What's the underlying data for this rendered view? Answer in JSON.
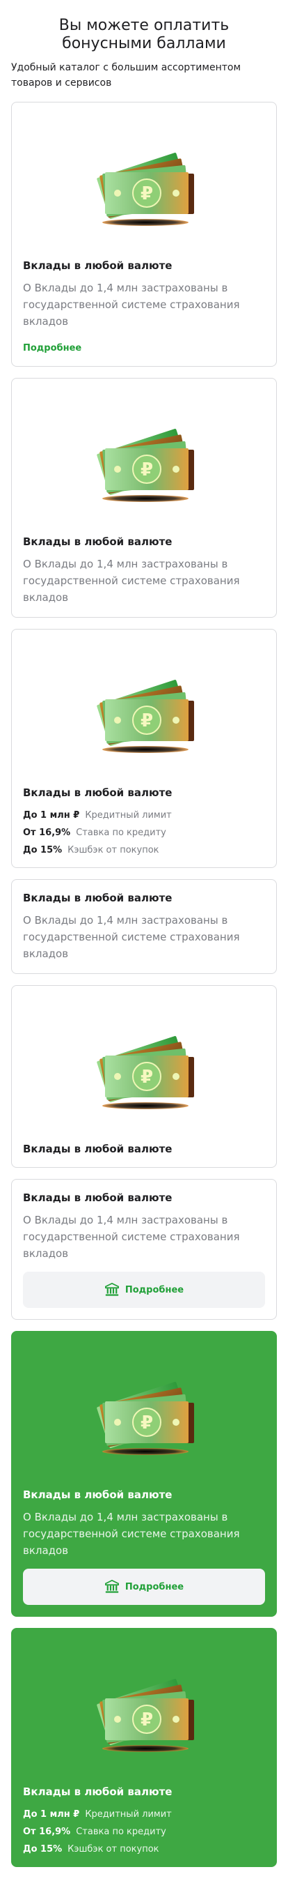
{
  "header": {
    "title": "Вы можете оплатить бонусными баллами",
    "subtitle": "Удобный каталог с большим ассортиментом товаров и сервисов"
  },
  "colors": {
    "accent_green": "#21a038",
    "card_green": "#3ea843",
    "muted_text": "#7a7c82",
    "border": "#d9dadd",
    "button_bg": "#f2f3f5"
  },
  "cards": [
    {
      "title": "Вклады в любой валюте",
      "desc": "О Вклады до 1,4 млн застрахованы в государственной системе страхования вкладов",
      "link": "Подробнее",
      "image_icon": "money-bills-icon"
    },
    {
      "title": "Вклады в любой валюте",
      "desc": "О Вклады до 1,4 млн застрахованы в государственной системе страхования вкладов",
      "image_icon": "money-bills-icon"
    },
    {
      "title": "Вклады в любой валюте",
      "image_icon": "money-bills-icon",
      "features": [
        {
          "value": "До 1 млн ₽",
          "label": "Кредитный лимит"
        },
        {
          "value": "От 16,9%",
          "label": "Ставка по кредиту"
        },
        {
          "value": "До 15%",
          "label": "Кэшбэк от покупок"
        }
      ]
    },
    {
      "title": "Вклады в любой валюте",
      "desc": "О Вклады до 1,4 млн застрахованы в государственной системе страхования вкладов"
    },
    {
      "title": "Вклады в любой валюте",
      "image_icon": "money-bills-icon"
    },
    {
      "title": "Вклады в любой валюте",
      "desc": "О Вклады до 1,4 млн застрахованы в государственной системе страхования вкладов",
      "button": "Подробнее",
      "button_icon": "bank-icon"
    },
    {
      "title": "Вклады в любой валюте",
      "desc": "О Вклады до 1,4 млн застрахованы в государственной системе страхования вкладов",
      "button": "Подробнее",
      "button_icon": "bank-icon",
      "image_icon": "money-bills-icon"
    },
    {
      "title": "Вклады в любой валюте",
      "image_icon": "money-bills-icon",
      "features": [
        {
          "value": "До 1 млн ₽",
          "label": "Кредитный лимит"
        },
        {
          "value": "От 16,9%",
          "label": "Ставка по кредиту"
        },
        {
          "value": "До 15%",
          "label": "Кэшбэк от покупок"
        }
      ]
    }
  ]
}
